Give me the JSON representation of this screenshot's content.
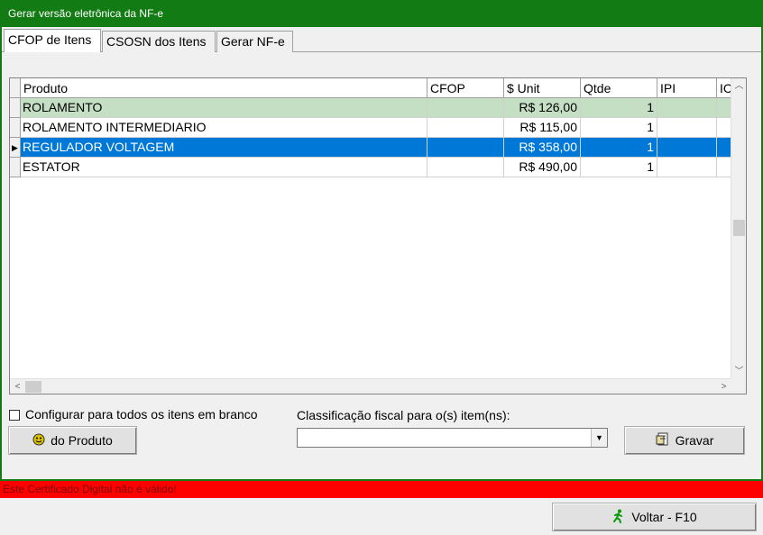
{
  "window": {
    "title": "Gerar versão eletrônica da NF-e"
  },
  "tabs": [
    {
      "label": "CFOP de Itens",
      "active": true
    },
    {
      "label": "CSOSN dos Itens",
      "active": false
    },
    {
      "label": "Gerar NF-e",
      "active": false
    }
  ],
  "grid": {
    "columns": [
      "Produto",
      "CFOP",
      "$ Unit",
      "Qtde",
      "IPI",
      "IC"
    ],
    "rows": [
      {
        "produto": "ROLAMENTO",
        "cfop": "",
        "unit": "R$  126,00",
        "qtde": "1",
        "ipi": "",
        "ic": "",
        "style": "highlight"
      },
      {
        "produto": "ROLAMENTO INTERMEDIARIO",
        "cfop": "",
        "unit": "R$  115,00",
        "qtde": "1",
        "ipi": "",
        "ic": "",
        "style": "normal"
      },
      {
        "produto": "REGULADOR VOLTAGEM",
        "cfop": "",
        "unit": "R$  358,00",
        "qtde": "1",
        "ipi": "",
        "ic": "",
        "style": "selected"
      },
      {
        "produto": "ESTATOR",
        "cfop": "",
        "unit": "R$  490,00",
        "qtde": "1",
        "ipi": "",
        "ic": "",
        "style": "normal"
      }
    ]
  },
  "controls": {
    "checkbox_label": "Configurar para todos os itens em branco",
    "checkbox_checked": false,
    "do_produto_label": "do Produto",
    "classificacao_label": "Classificação fiscal para o(s) item(ns):",
    "classificacao_value": "",
    "gravar_label": "Gravar",
    "voltar_label": "Voltar - F10"
  },
  "status": {
    "message": "Este Certificado Digital não é válido!"
  },
  "colors": {
    "title_bar": "#137b13",
    "highlight_row": "#c4dfc4",
    "selected_row": "#0078d7",
    "status_bg": "#ff0000"
  },
  "icons": {
    "do_produto": "smiley-icon",
    "gravar": "save-document-icon",
    "voltar": "running-man-icon"
  }
}
